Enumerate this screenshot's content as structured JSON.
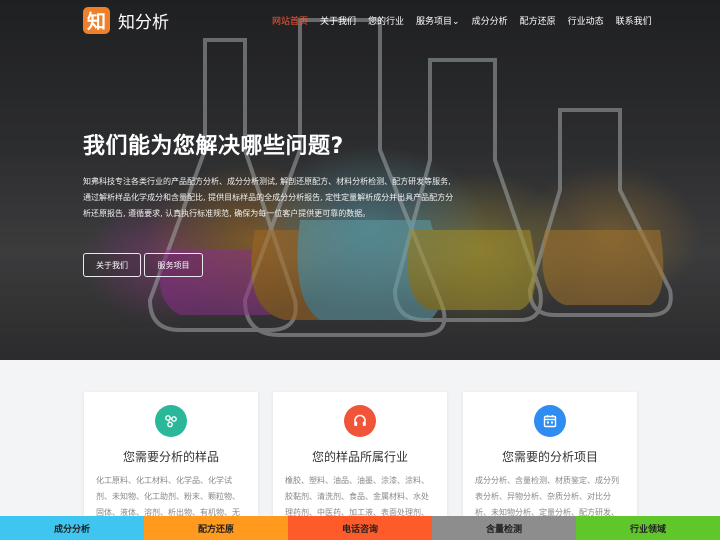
{
  "brand": {
    "logo_glyph": "知",
    "name": "知分析",
    "color": "#f07f2a"
  },
  "nav": {
    "items": [
      {
        "label": "网站首页",
        "active": true
      },
      {
        "label": "关于我们"
      },
      {
        "label": "您的行业"
      },
      {
        "label": "服务项目⌄"
      },
      {
        "label": "成分分析"
      },
      {
        "label": "配方还原"
      },
      {
        "label": "行业动态"
      },
      {
        "label": "联系我们"
      }
    ],
    "active_color": "#ff5a36"
  },
  "hero": {
    "title": "我们能为您解决哪些问题?",
    "description": "知弗科技专注各类行业的产品配方分析、成分分析测试, 解剖还原配方、材料分析检测、配方研发等服务, 通过解析样品化学成分和含量配比, 提供目标样品的全成分分析报告, 定性定量解析成分并出具产品配方分析还原报告, 遵循要求, 认真执行标准规范, 确保为每一位客户提供更可靠的数据。",
    "buttons": {
      "about": "关于我们",
      "service": "服务项目"
    }
  },
  "cards": [
    {
      "icon": "molecule-icon",
      "icon_color": "#2bb79a",
      "title": "您需要分析的样品",
      "text": "化工原料、化工材料、化学品、化学试剂、未知物、化工助剂、粉末、颗粒物、固体、液体、溶剂、析出物、有机物、无机物、高分子等"
    },
    {
      "icon": "headset-icon",
      "icon_color": "#f0553a",
      "title": "您的样品所属行业",
      "text": "橡胶、塑料、油品、油墨、涂漆、涂料、胶黏剂、清洗剂、食品、金属材料、水处理药剂、中医药、加工液、表面处理剂、纺织助剂等"
    },
    {
      "icon": "calendar-icon",
      "icon_color": "#2f8cf0",
      "title": "您需要的分析项目",
      "text": "成分分析、含量检测、材质鉴定、成分列表分析、异物分析、杂质分析、对比分析、未知物分析、定量分析、配方研发、失效分析等"
    }
  ],
  "bottom_bar": [
    {
      "label": "成分分析",
      "color": "#3ec5f0"
    },
    {
      "label": "配方还原",
      "color": "#ff9a1f"
    },
    {
      "label": "电话咨询",
      "color": "#ff5a2a"
    },
    {
      "label": "含量检测",
      "color": "#8d8d8d"
    },
    {
      "label": "行业领域",
      "color": "#5fc72a"
    }
  ]
}
